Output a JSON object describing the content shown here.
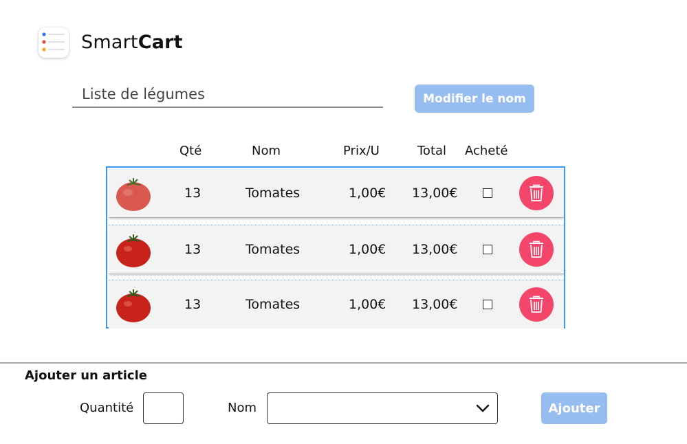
{
  "app": {
    "name_light": "Smart",
    "name_bold": "Cart",
    "logo_icon": "reminders-list-icon"
  },
  "list": {
    "name": "Liste de légumes",
    "rename_label": "Modifier le nom"
  },
  "table": {
    "headers": [
      "Qté",
      "Nom",
      "Prix/U",
      "Total",
      "Acheté"
    ],
    "rows": [
      {
        "qty": "13",
        "name": "Tomates",
        "unit_price": "1,00€",
        "total": "13,00€",
        "purchased": false
      },
      {
        "qty": "13",
        "name": "Tomates",
        "unit_price": "1,00€",
        "total": "13,00€",
        "purchased": false
      },
      {
        "qty": "13",
        "name": "Tomates",
        "unit_price": "1,00€",
        "total": "13,00€",
        "purchased": false
      }
    ]
  },
  "add_form": {
    "title": "Ajouter un article",
    "quantity_label": "Quantité",
    "name_label": "Nom",
    "quantity_value": "",
    "name_value": "",
    "submit_label": "Ajouter"
  },
  "colors": {
    "accent_button": "#97bdf0",
    "delete": "#f4456a",
    "table_border": "#3a97ef",
    "row_bg": "#f3f3f3"
  }
}
